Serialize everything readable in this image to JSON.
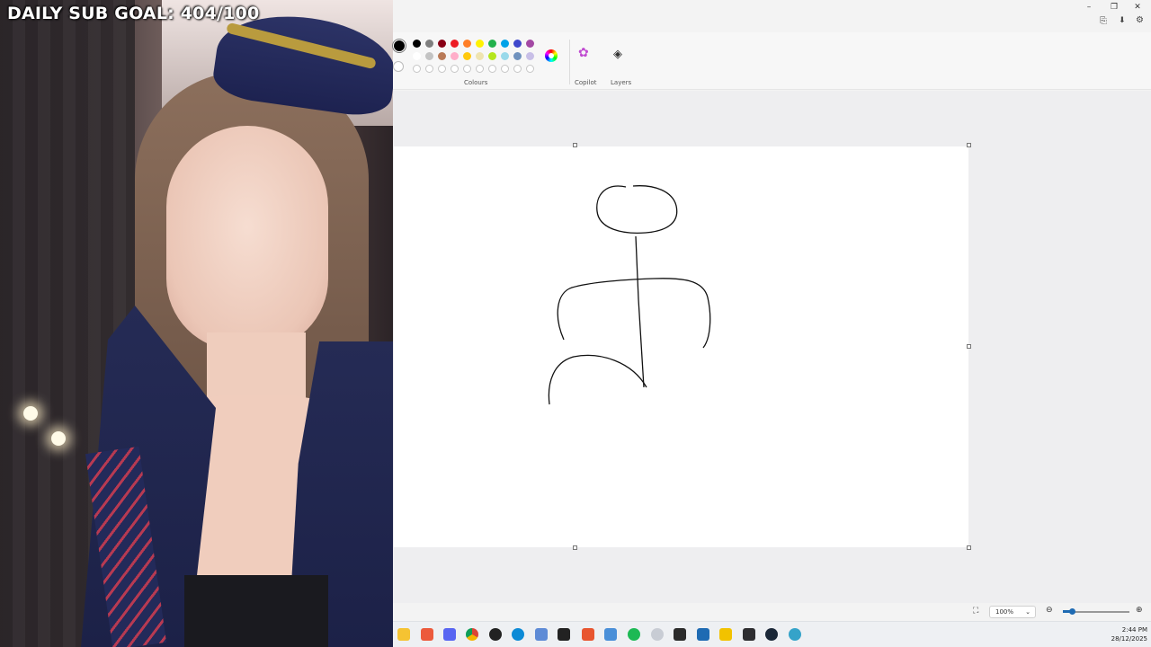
{
  "overlay": {
    "sub_goal": "DAILY SUB GOAL: 404/100"
  },
  "toolbar": {
    "colours_label": "Colours",
    "copilot_label": "Copilot",
    "layers_label": "Layers",
    "palette_row1": [
      "#000000",
      "#7f7f7f",
      "#880015",
      "#ed1c24",
      "#ff7f27",
      "#fff200",
      "#22b14c",
      "#00a2e8",
      "#3f48cc",
      "#a349a4"
    ],
    "palette_row2": [
      "#ffffff",
      "#c3c3c3",
      "#b97a57",
      "#ffaec9",
      "#ffc90e",
      "#efe4b0",
      "#b5e61d",
      "#99d9ea",
      "#7092be",
      "#c8bfe7"
    ],
    "primary_color": "#000000"
  },
  "statusbar": {
    "zoom": "100%"
  },
  "taskbar": {
    "time": "2:44 PM",
    "date": "28/12/2025"
  }
}
